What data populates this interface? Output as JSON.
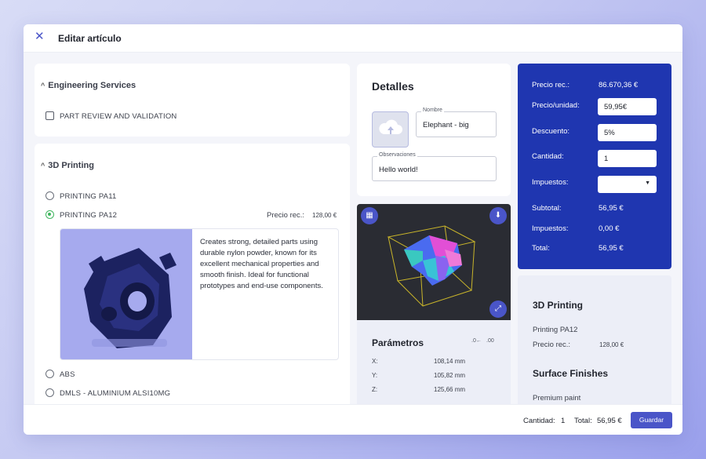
{
  "header": {
    "title": "Editar artículo"
  },
  "left": {
    "engineering": {
      "title": "Engineering Services",
      "option": "PART REVIEW AND VALIDATION"
    },
    "printing": {
      "title": "3D Printing",
      "options": [
        "PRINTING PA11",
        "PRINTING PA12",
        "ABS",
        "DMLS - ALUMINIUM ALSI10MG"
      ],
      "selected_price_label": "Precio rec.:",
      "selected_price_value": "128,00 €",
      "description": "Creates strong, detailed parts using durable nylon powder, known for its excellent mechanical properties and smooth finish. Ideal for functional prototypes and end-use components."
    }
  },
  "details": {
    "title": "Detalles",
    "name_label": "Nombre",
    "name_value": "Elephant - big",
    "notes_label": "Observaciones",
    "notes_value": "Hello world!"
  },
  "params": {
    "title": "Parámetros",
    "rows": [
      {
        "label": "X:",
        "value": "108,14 mm"
      },
      {
        "label": "Y:",
        "value": "105,82 mm"
      },
      {
        "label": "Z:",
        "value": "125,66 mm"
      }
    ]
  },
  "price": {
    "rec_label": "Precio rec.:",
    "rec_value": "86.670,36 €",
    "unit_label": "Precio/unidad:",
    "unit_value": "59,95€",
    "discount_label": "Descuento:",
    "discount_value": "5%",
    "qty_label": "Cantidad:",
    "qty_value": "1",
    "tax_label": "Impuestos:",
    "subtotal_label": "Subtotal:",
    "subtotal_value": "56,95 €",
    "taxes_label": "Impuestos:",
    "taxes_value": "0,00 €",
    "total_label": "Total:",
    "total_value": "56,95 €"
  },
  "summary": {
    "printing_title": "3D Printing",
    "material": "Printing PA12",
    "rec_label": "Precio rec.:",
    "rec_value": "128,00 €",
    "finishes_title": "Surface Finishes",
    "finish": "Premium paint"
  },
  "footer": {
    "qty_label": "Cantidad:",
    "qty_value": "1",
    "total_label": "Total:",
    "total_value": "56,95 €",
    "save_label": "Guardar"
  },
  "colors": {
    "accent": "#4a55c8",
    "price_panel": "#1f36b0",
    "selected_radio": "#3fb55e"
  }
}
